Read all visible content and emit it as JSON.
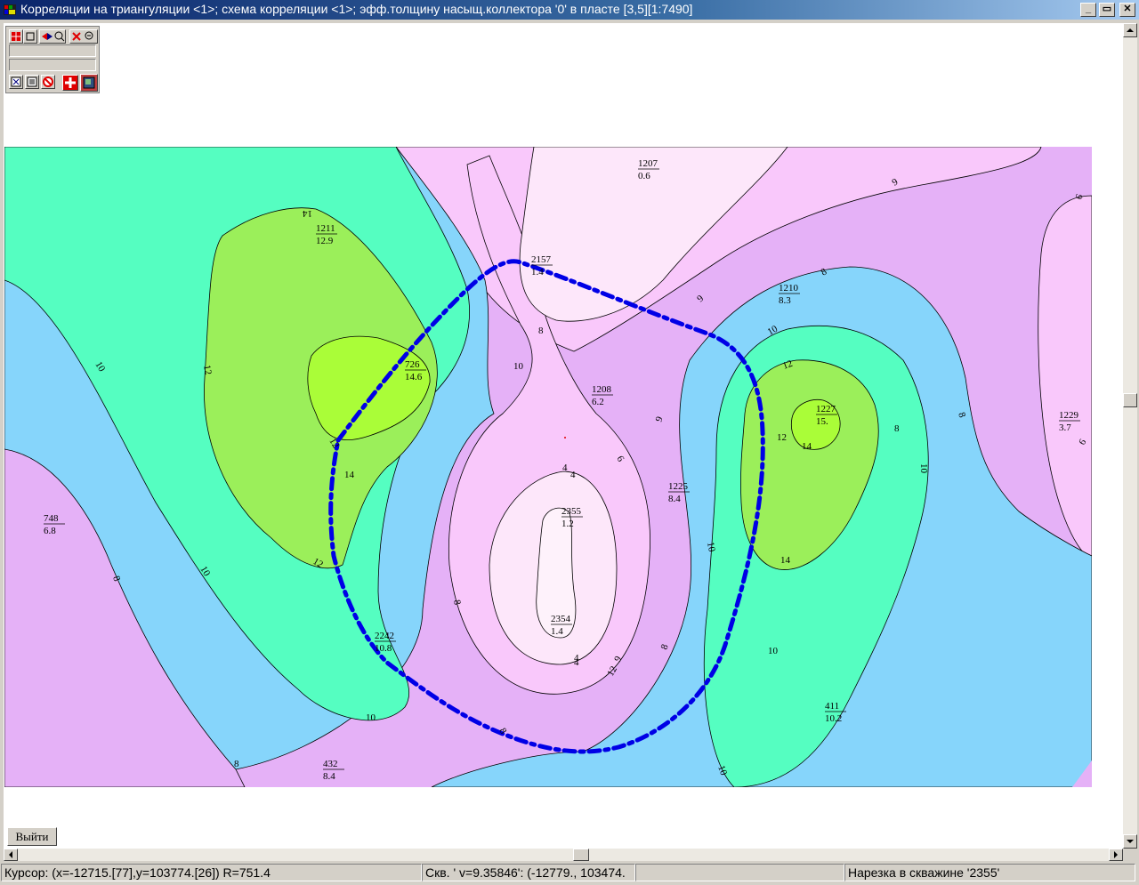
{
  "window": {
    "title": "Корреляции на триангуляции <1>; схема корреляции <1>; эфф.толщину насыщ.коллектора '0'  в пласте [3,5][1:7490]",
    "minimize_glyph": "_",
    "maximize_glyph": "▭",
    "close_glyph": "✕"
  },
  "toolbar": {
    "icons": [
      "grid-icon",
      "frame-icon",
      "fit-zoom-icon",
      "zoom-in-icon",
      "close-zoom-icon",
      "zoom-out-icon",
      "close-icon",
      "list-icon",
      "stop-icon",
      "move-icon",
      "map-view-icon"
    ]
  },
  "exit_button": {
    "label": "Выйти"
  },
  "status": {
    "cursor": "Курсор: (x=-12715.[77],y=103774.[26]) R=751.4",
    "well": "Скв. ' v=9.35846': (-12779., 103474.",
    "empty": "",
    "cut": "Нарезка в скважине '2355'"
  },
  "colors": {
    "level_8": "#e5b1f7",
    "level_9": "#f9c8fb",
    "level_low": "#fde7fa",
    "level_10": "#86d5fb",
    "level_12": "#55fec1",
    "level_14": "#9bef5a",
    "level_15": "#aafd38",
    "profile_line": "#0000e6"
  },
  "wells": [
    {
      "id": "1207",
      "value": "0.6"
    },
    {
      "id": "1211",
      "value": "12.9"
    },
    {
      "id": "2157",
      "value": "1.4"
    },
    {
      "id": "1210",
      "value": "8.3"
    },
    {
      "id": "726",
      "value": "14.6"
    },
    {
      "id": "1208",
      "value": "6.2"
    },
    {
      "id": "1227",
      "value": "15."
    },
    {
      "id": "1229",
      "value": "3.7"
    },
    {
      "id": "1225",
      "value": "8.4"
    },
    {
      "id": "2355",
      "value": "1.2"
    },
    {
      "id": "748",
      "value": "6.8"
    },
    {
      "id": "2354",
      "value": "1.4"
    },
    {
      "id": "2242",
      "value": "10.8"
    },
    {
      "id": "411",
      "value": "10.2"
    },
    {
      "id": "432",
      "value": "8.4"
    }
  ],
  "contour_labels": [
    "9",
    "6",
    "8",
    "9",
    "10",
    "12",
    "14",
    "12",
    "10",
    "12",
    "14",
    "8",
    "9",
    "4",
    "6",
    "8",
    "10",
    "8",
    "10",
    "12",
    "14",
    "10",
    "8",
    "8",
    "10",
    "12",
    "10",
    "8",
    "6",
    "4",
    "9",
    "8",
    "10",
    "8",
    "12",
    "14",
    "10",
    "4",
    "4"
  ]
}
